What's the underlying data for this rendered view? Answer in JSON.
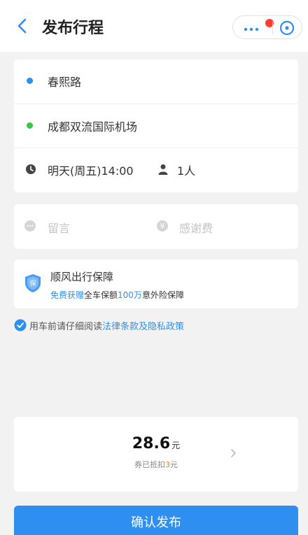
{
  "header": {
    "title": "发布行程"
  },
  "route": {
    "origin": "春熙路",
    "destination": "成都双流国际机场",
    "time": "明天(周五)14:00",
    "passengers": "1人"
  },
  "extras": {
    "message_placeholder": "留言",
    "thanks_fee_placeholder": "感谢费"
  },
  "insurance": {
    "title": "顺风出行保障",
    "sub_part1": "免费获赠",
    "sub_part2": "全车保额",
    "sub_part3": "100万",
    "sub_part4": "意外险保障"
  },
  "agreement": {
    "text": "用车前请仔细阅读",
    "link": "法律条款及隐私政策"
  },
  "price": {
    "amount": "28.6",
    "unit": "元",
    "coupon_prefix": "券已抵扣",
    "coupon_amount": "3",
    "coupon_suffix": "元"
  },
  "actions": {
    "confirm_label": "确认发布"
  },
  "colors": {
    "accent": "#2f8ff0",
    "origin_dot": "#2f8ff0",
    "destination_dot": "#39c44d",
    "discount": "#ff7a00",
    "notification": "#ff3b30"
  },
  "icons": {
    "back": "chevron-left-icon",
    "more": "more-dots-icon",
    "close": "close-circle-icon",
    "time": "clock-icon",
    "passenger": "person-icon",
    "message": "chat-bubble-icon",
    "thanks_fee": "yen-coin-icon",
    "insurance": "shield-icon",
    "agree": "checkmark-circle-icon",
    "price_detail": "chevron-right-icon"
  }
}
